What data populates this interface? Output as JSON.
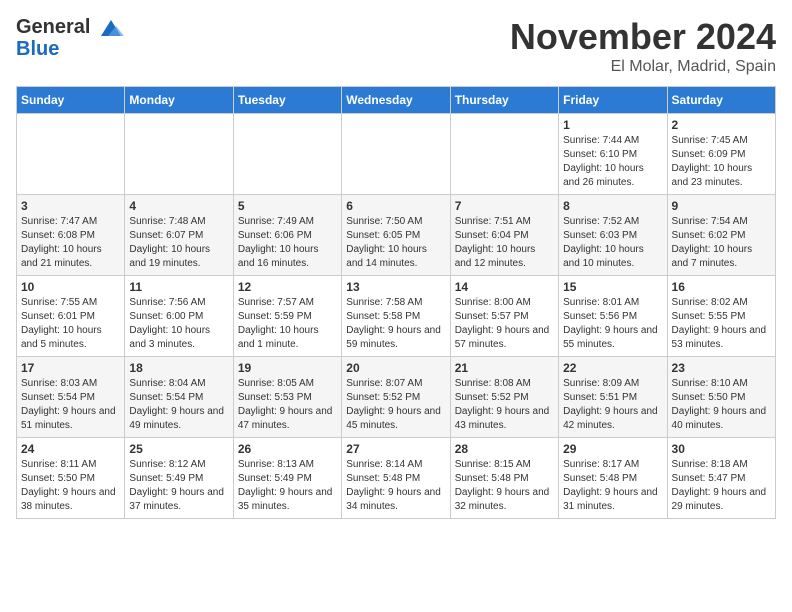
{
  "header": {
    "logo_line1": "General",
    "logo_line2": "Blue",
    "month_title": "November 2024",
    "location": "El Molar, Madrid, Spain"
  },
  "days_of_week": [
    "Sunday",
    "Monday",
    "Tuesday",
    "Wednesday",
    "Thursday",
    "Friday",
    "Saturday"
  ],
  "weeks": [
    [
      {
        "day": "",
        "info": ""
      },
      {
        "day": "",
        "info": ""
      },
      {
        "day": "",
        "info": ""
      },
      {
        "day": "",
        "info": ""
      },
      {
        "day": "",
        "info": ""
      },
      {
        "day": "1",
        "info": "Sunrise: 7:44 AM\nSunset: 6:10 PM\nDaylight: 10 hours and 26 minutes."
      },
      {
        "day": "2",
        "info": "Sunrise: 7:45 AM\nSunset: 6:09 PM\nDaylight: 10 hours and 23 minutes."
      }
    ],
    [
      {
        "day": "3",
        "info": "Sunrise: 7:47 AM\nSunset: 6:08 PM\nDaylight: 10 hours and 21 minutes."
      },
      {
        "day": "4",
        "info": "Sunrise: 7:48 AM\nSunset: 6:07 PM\nDaylight: 10 hours and 19 minutes."
      },
      {
        "day": "5",
        "info": "Sunrise: 7:49 AM\nSunset: 6:06 PM\nDaylight: 10 hours and 16 minutes."
      },
      {
        "day": "6",
        "info": "Sunrise: 7:50 AM\nSunset: 6:05 PM\nDaylight: 10 hours and 14 minutes."
      },
      {
        "day": "7",
        "info": "Sunrise: 7:51 AM\nSunset: 6:04 PM\nDaylight: 10 hours and 12 minutes."
      },
      {
        "day": "8",
        "info": "Sunrise: 7:52 AM\nSunset: 6:03 PM\nDaylight: 10 hours and 10 minutes."
      },
      {
        "day": "9",
        "info": "Sunrise: 7:54 AM\nSunset: 6:02 PM\nDaylight: 10 hours and 7 minutes."
      }
    ],
    [
      {
        "day": "10",
        "info": "Sunrise: 7:55 AM\nSunset: 6:01 PM\nDaylight: 10 hours and 5 minutes."
      },
      {
        "day": "11",
        "info": "Sunrise: 7:56 AM\nSunset: 6:00 PM\nDaylight: 10 hours and 3 minutes."
      },
      {
        "day": "12",
        "info": "Sunrise: 7:57 AM\nSunset: 5:59 PM\nDaylight: 10 hours and 1 minute."
      },
      {
        "day": "13",
        "info": "Sunrise: 7:58 AM\nSunset: 5:58 PM\nDaylight: 9 hours and 59 minutes."
      },
      {
        "day": "14",
        "info": "Sunrise: 8:00 AM\nSunset: 5:57 PM\nDaylight: 9 hours and 57 minutes."
      },
      {
        "day": "15",
        "info": "Sunrise: 8:01 AM\nSunset: 5:56 PM\nDaylight: 9 hours and 55 minutes."
      },
      {
        "day": "16",
        "info": "Sunrise: 8:02 AM\nSunset: 5:55 PM\nDaylight: 9 hours and 53 minutes."
      }
    ],
    [
      {
        "day": "17",
        "info": "Sunrise: 8:03 AM\nSunset: 5:54 PM\nDaylight: 9 hours and 51 minutes."
      },
      {
        "day": "18",
        "info": "Sunrise: 8:04 AM\nSunset: 5:54 PM\nDaylight: 9 hours and 49 minutes."
      },
      {
        "day": "19",
        "info": "Sunrise: 8:05 AM\nSunset: 5:53 PM\nDaylight: 9 hours and 47 minutes."
      },
      {
        "day": "20",
        "info": "Sunrise: 8:07 AM\nSunset: 5:52 PM\nDaylight: 9 hours and 45 minutes."
      },
      {
        "day": "21",
        "info": "Sunrise: 8:08 AM\nSunset: 5:52 PM\nDaylight: 9 hours and 43 minutes."
      },
      {
        "day": "22",
        "info": "Sunrise: 8:09 AM\nSunset: 5:51 PM\nDaylight: 9 hours and 42 minutes."
      },
      {
        "day": "23",
        "info": "Sunrise: 8:10 AM\nSunset: 5:50 PM\nDaylight: 9 hours and 40 minutes."
      }
    ],
    [
      {
        "day": "24",
        "info": "Sunrise: 8:11 AM\nSunset: 5:50 PM\nDaylight: 9 hours and 38 minutes."
      },
      {
        "day": "25",
        "info": "Sunrise: 8:12 AM\nSunset: 5:49 PM\nDaylight: 9 hours and 37 minutes."
      },
      {
        "day": "26",
        "info": "Sunrise: 8:13 AM\nSunset: 5:49 PM\nDaylight: 9 hours and 35 minutes."
      },
      {
        "day": "27",
        "info": "Sunrise: 8:14 AM\nSunset: 5:48 PM\nDaylight: 9 hours and 34 minutes."
      },
      {
        "day": "28",
        "info": "Sunrise: 8:15 AM\nSunset: 5:48 PM\nDaylight: 9 hours and 32 minutes."
      },
      {
        "day": "29",
        "info": "Sunrise: 8:17 AM\nSunset: 5:48 PM\nDaylight: 9 hours and 31 minutes."
      },
      {
        "day": "30",
        "info": "Sunrise: 8:18 AM\nSunset: 5:47 PM\nDaylight: 9 hours and 29 minutes."
      }
    ]
  ]
}
